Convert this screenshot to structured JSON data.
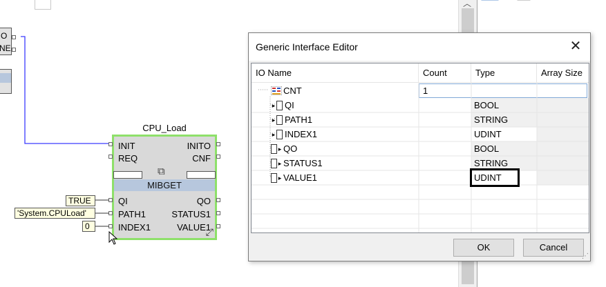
{
  "canvas": {
    "left_fragment": {
      "line1": "O",
      "line2": "NE"
    },
    "function_block": {
      "instance_name": "CPU_Load",
      "type_name": "MIBGET",
      "event_inputs": [
        "INIT",
        "REQ"
      ],
      "event_outputs": [
        "INITO",
        "CNF"
      ],
      "data_inputs": [
        "QI",
        "PATH1",
        "INDEX1"
      ],
      "data_outputs": [
        "QO",
        "STATUS1",
        "VALUE1"
      ]
    },
    "params": {
      "qi": "TRUE",
      "path1": "'System.CPULoad'",
      "index1": "0"
    },
    "colors": {
      "block_border": "#8ee06a",
      "wire": "#3a3aff",
      "type_band": "#b7c7dd"
    }
  },
  "dialog": {
    "title": "Generic Interface Editor",
    "close_icon": "close-icon",
    "columns": [
      "IO Name",
      "Count",
      "Type",
      "Array Size"
    ],
    "rows": [
      {
        "name": "CNT",
        "count": "1",
        "type": "",
        "array_size": ""
      },
      {
        "name": "QI",
        "count": "",
        "type": "BOOL",
        "array_size": ""
      },
      {
        "name": "PATH1",
        "count": "",
        "type": "STRING",
        "array_size": ""
      },
      {
        "name": "INDEX1",
        "count": "",
        "type": "UDINT",
        "array_size": ""
      },
      {
        "name": "QO",
        "count": "",
        "type": "BOOL",
        "array_size": ""
      },
      {
        "name": "STATUS1",
        "count": "",
        "type": "STRING",
        "array_size": ""
      },
      {
        "name": "VALUE1",
        "count": "",
        "type": "UDINT",
        "array_size": ""
      }
    ],
    "ok_label": "OK",
    "cancel_label": "Cancel"
  }
}
